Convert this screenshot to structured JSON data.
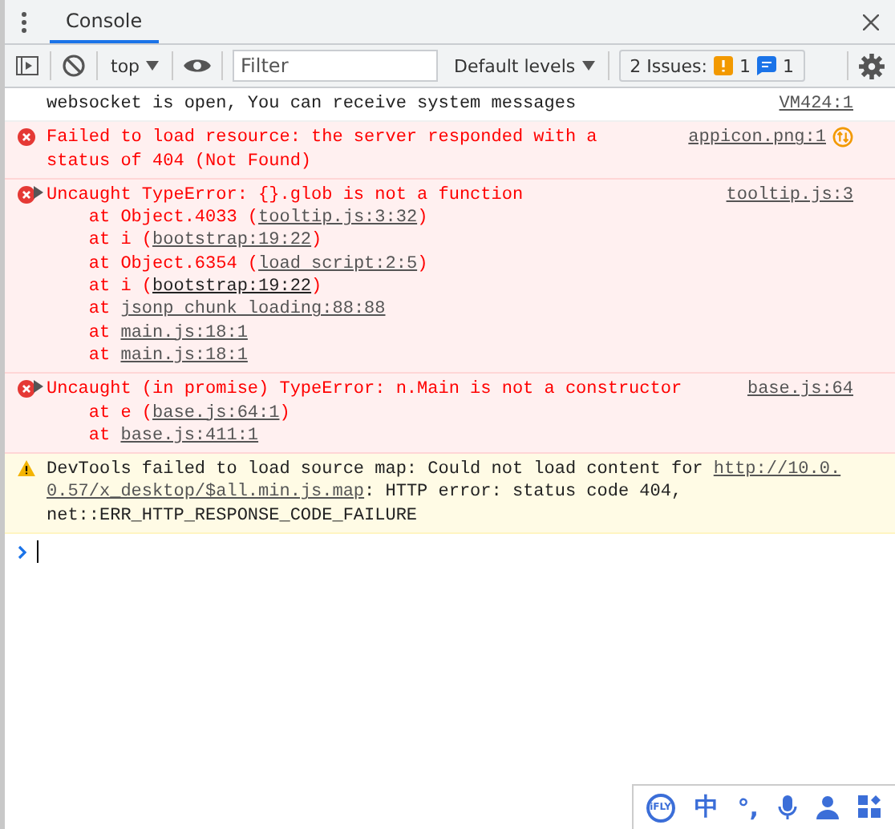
{
  "tabs": [
    {
      "label": "Console",
      "selected": true
    }
  ],
  "toolbar": {
    "context": "top",
    "filter_placeholder": "Filter",
    "levels": "Default levels",
    "issues": {
      "label": "2 Issues:",
      "warnings": "1",
      "infos": "1"
    }
  },
  "messages": [
    {
      "kind": "info",
      "expandable": false,
      "source": "VM424:1",
      "lines": [
        [
          {
            "t": "websocket is open, You can receive system messages"
          }
        ]
      ]
    },
    {
      "kind": "error",
      "expandable": false,
      "source": "appicon.png:1",
      "network": true,
      "lines": [
        [
          {
            "t": "Failed to load resource: the server responded with a"
          }
        ],
        [
          {
            "t": "status of 404 (Not Found)"
          }
        ]
      ]
    },
    {
      "kind": "error",
      "expandable": true,
      "source": "tooltip.js:3",
      "lines": [
        [
          {
            "t": "Uncaught TypeError: {}.glob is not a function"
          }
        ],
        [
          {
            "t": "    at Object.4033 ("
          },
          {
            "t": "tooltip.js:3:32",
            "link": true,
            "hover": false
          },
          {
            "t": ")"
          }
        ],
        [
          {
            "t": "    at i ("
          },
          {
            "t": "bootstrap:19:22",
            "link": true,
            "hover": false
          },
          {
            "t": ")"
          }
        ],
        [
          {
            "t": "    at Object.6354 ("
          },
          {
            "t": "load script:2:5",
            "link": true,
            "hover": false
          },
          {
            "t": ")"
          }
        ],
        [
          {
            "t": "    at i ("
          },
          {
            "t": "bootstrap:19:22",
            "link": true,
            "hover": true
          },
          {
            "t": ")"
          }
        ],
        [
          {
            "t": "    at "
          },
          {
            "t": "jsonp chunk loading:88:88",
            "link": true,
            "hover": false
          }
        ],
        [
          {
            "t": "    at "
          },
          {
            "t": "main.js:18:1",
            "link": true,
            "hover": false
          }
        ],
        [
          {
            "t": "    at "
          },
          {
            "t": "main.js:18:1",
            "link": true,
            "hover": false
          }
        ]
      ]
    },
    {
      "kind": "error",
      "expandable": true,
      "source": "base.js:64",
      "lines": [
        [
          {
            "t": "Uncaught (in promise) TypeError: n.Main is not a constructor"
          }
        ],
        [
          {
            "t": "    at e ("
          },
          {
            "t": "base.js:64:1",
            "link": true,
            "hover": false
          },
          {
            "t": ")"
          }
        ],
        [
          {
            "t": "    at "
          },
          {
            "t": "base.js:411:1",
            "link": true,
            "hover": false
          }
        ]
      ]
    },
    {
      "kind": "warning",
      "expandable": false,
      "lines": [
        [
          {
            "t": "DevTools failed to load source map: Could not load content for "
          },
          {
            "t": "http://10.0.",
            "link": true,
            "hover": false
          }
        ],
        [
          {
            "t": "0.57/x_desktop/$all.min.js.map",
            "link": true,
            "hover": false
          },
          {
            "t": ": HTTP error: status code 404,"
          }
        ],
        [
          {
            "t": "net::ERR_HTTP_RESPONSE_CODE_FAILURE"
          }
        ]
      ]
    }
  ],
  "ime_toolbar": {
    "logo": "iFLY",
    "mode": "中",
    "punctuation": "°,"
  }
}
